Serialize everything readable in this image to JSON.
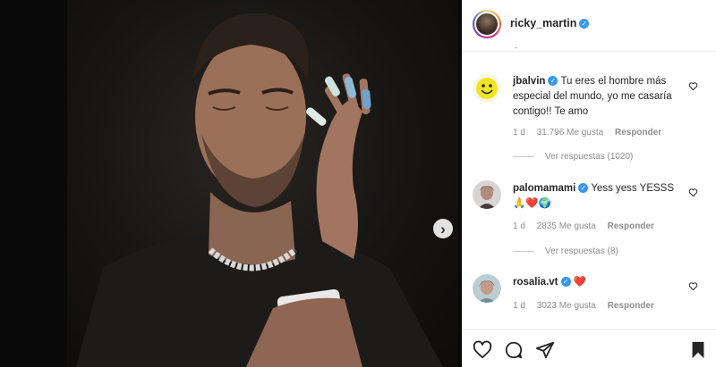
{
  "post": {
    "username": "ricky_martin",
    "verified_glyph": "✓",
    "stray_mark": "˘"
  },
  "comments": [
    {
      "username": "jbalvin",
      "text": "Tu eres el hombre más especial del mundo, yo me casaría contigo!! Te amo",
      "time": "1 d",
      "likes": "31.796 Me gusta",
      "reply": "Responder",
      "view_replies": "Ver respuestas (1020)"
    },
    {
      "username": "palomamami",
      "text": "Yess yess YESSS",
      "emojis": "🙏❤️🌍",
      "time": "1 d",
      "likes": "2835 Me gusta",
      "reply": "Responder",
      "view_replies": "Ver respuestas (8)"
    },
    {
      "username": "rosalia.vt",
      "emojis": "❤️",
      "time": "1 d",
      "likes": "3023 Me gusta",
      "reply": "Responder"
    }
  ],
  "nav": {
    "next_glyph": "›"
  },
  "icons": {
    "heart": "heart-icon",
    "comment": "comment-icon",
    "share": "share-icon",
    "bookmark": "bookmark-icon"
  },
  "colors": {
    "verified": "#3897f0",
    "text": "#262626",
    "muted": "#8e8e8e",
    "heart_red": "#ed4956"
  }
}
